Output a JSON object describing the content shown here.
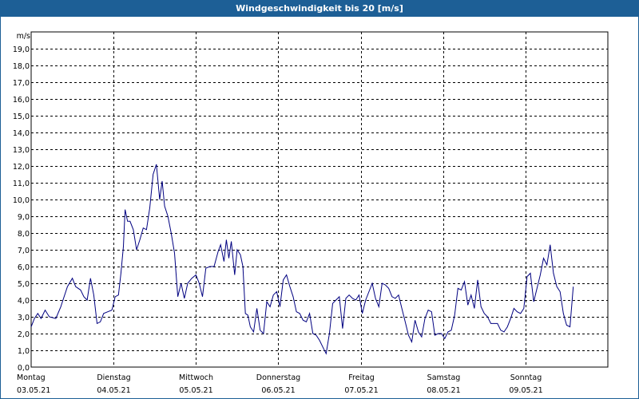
{
  "window": {
    "title": "Windgeschwindigkeit bis 20 [m/s]"
  },
  "colors": {
    "titlebar": "#1d5f96",
    "series": "#000080",
    "grid": "#000000"
  },
  "chart_data": {
    "type": "line",
    "title": "Windgeschwindigkeit bis 20 [m/s]",
    "ylabel": "m/s",
    "ylim": [
      0,
      20
    ],
    "yticks": [
      "0,0",
      "1,0",
      "2,0",
      "3,0",
      "4,0",
      "5,0",
      "6,0",
      "7,0",
      "8,0",
      "9,0",
      "10,0",
      "11,0",
      "12,0",
      "13,0",
      "14,0",
      "15,0",
      "16,0",
      "17,0",
      "18,0",
      "19,0"
    ],
    "xlim": [
      0,
      7
    ],
    "grid": true,
    "x_categories": [
      {
        "day": "Montag",
        "date": "03.05.21"
      },
      {
        "day": "Dienstag",
        "date": "04.05.21"
      },
      {
        "day": "Mittwoch",
        "date": "05.05.21"
      },
      {
        "day": "Donnerstag",
        "date": "06.05.21"
      },
      {
        "day": "Freitag",
        "date": "07.05.21"
      },
      {
        "day": "Samstag",
        "date": "08.05.21"
      },
      {
        "day": "Sonntag",
        "date": "09.05.21"
      }
    ],
    "series": [
      {
        "points": [
          [
            0.0,
            2.4
          ],
          [
            0.04,
            2.9
          ],
          [
            0.08,
            3.2
          ],
          [
            0.12,
            2.9
          ],
          [
            0.17,
            3.4
          ],
          [
            0.22,
            3.0
          ],
          [
            0.3,
            2.9
          ],
          [
            0.36,
            3.6
          ],
          [
            0.44,
            4.8
          ],
          [
            0.5,
            5.3
          ],
          [
            0.54,
            4.8
          ],
          [
            0.6,
            4.6
          ],
          [
            0.64,
            4.2
          ],
          [
            0.68,
            4.0
          ],
          [
            0.72,
            5.3
          ],
          [
            0.76,
            4.3
          ],
          [
            0.8,
            2.6
          ],
          [
            0.84,
            2.7
          ],
          [
            0.88,
            3.2
          ],
          [
            0.93,
            3.3
          ],
          [
            0.98,
            3.4
          ],
          [
            1.02,
            4.2
          ],
          [
            1.06,
            4.3
          ],
          [
            1.09,
            5.6
          ],
          [
            1.12,
            7.2
          ],
          [
            1.14,
            9.4
          ],
          [
            1.17,
            8.7
          ],
          [
            1.2,
            8.7
          ],
          [
            1.24,
            8.2
          ],
          [
            1.28,
            7.0
          ],
          [
            1.32,
            7.6
          ],
          [
            1.36,
            8.3
          ],
          [
            1.4,
            8.2
          ],
          [
            1.44,
            9.5
          ],
          [
            1.48,
            11.5
          ],
          [
            1.52,
            12.1
          ],
          [
            1.56,
            10.0
          ],
          [
            1.59,
            11.1
          ],
          [
            1.62,
            9.6
          ],
          [
            1.66,
            9.0
          ],
          [
            1.7,
            8.0
          ],
          [
            1.74,
            6.8
          ],
          [
            1.78,
            4.2
          ],
          [
            1.82,
            5.0
          ],
          [
            1.86,
            4.1
          ],
          [
            1.9,
            5.0
          ],
          [
            1.95,
            5.3
          ],
          [
            2.0,
            5.5
          ],
          [
            2.04,
            5.0
          ],
          [
            2.08,
            4.2
          ],
          [
            2.12,
            5.9
          ],
          [
            2.17,
            6.0
          ],
          [
            2.22,
            6.0
          ],
          [
            2.27,
            6.9
          ],
          [
            2.3,
            7.3
          ],
          [
            2.34,
            6.3
          ],
          [
            2.37,
            7.6
          ],
          [
            2.4,
            6.5
          ],
          [
            2.43,
            7.5
          ],
          [
            2.47,
            5.5
          ],
          [
            2.5,
            7.0
          ],
          [
            2.54,
            6.7
          ],
          [
            2.57,
            6.0
          ],
          [
            2.6,
            3.2
          ],
          [
            2.63,
            3.1
          ],
          [
            2.66,
            2.4
          ],
          [
            2.7,
            2.1
          ],
          [
            2.74,
            3.5
          ],
          [
            2.78,
            2.2
          ],
          [
            2.82,
            2.0
          ],
          [
            2.86,
            3.9
          ],
          [
            2.9,
            3.6
          ],
          [
            2.94,
            4.3
          ],
          [
            2.98,
            4.5
          ],
          [
            3.02,
            3.6
          ],
          [
            3.06,
            5.2
          ],
          [
            3.1,
            5.5
          ],
          [
            3.14,
            4.8
          ],
          [
            3.18,
            4.2
          ],
          [
            3.22,
            3.3
          ],
          [
            3.26,
            3.2
          ],
          [
            3.3,
            2.8
          ],
          [
            3.34,
            2.7
          ],
          [
            3.38,
            3.2
          ],
          [
            3.42,
            2.0
          ],
          [
            3.46,
            1.9
          ],
          [
            3.5,
            1.6
          ],
          [
            3.54,
            1.2
          ],
          [
            3.58,
            0.8
          ],
          [
            3.62,
            2.0
          ],
          [
            3.66,
            3.8
          ],
          [
            3.7,
            4.0
          ],
          [
            3.74,
            4.2
          ],
          [
            3.78,
            2.3
          ],
          [
            3.82,
            4.1
          ],
          [
            3.86,
            4.3
          ],
          [
            3.9,
            4.1
          ],
          [
            3.94,
            4.0
          ],
          [
            3.98,
            4.3
          ],
          [
            4.02,
            3.2
          ],
          [
            4.06,
            4.0
          ],
          [
            4.1,
            4.5
          ],
          [
            4.14,
            5.0
          ],
          [
            4.18,
            4.1
          ],
          [
            4.22,
            3.6
          ],
          [
            4.26,
            5.0
          ],
          [
            4.3,
            4.9
          ],
          [
            4.34,
            4.7
          ],
          [
            4.38,
            4.2
          ],
          [
            4.42,
            4.1
          ],
          [
            4.46,
            4.3
          ],
          [
            4.5,
            3.5
          ],
          [
            4.54,
            2.7
          ],
          [
            4.58,
            1.9
          ],
          [
            4.62,
            1.5
          ],
          [
            4.66,
            2.8
          ],
          [
            4.7,
            2.1
          ],
          [
            4.74,
            1.8
          ],
          [
            4.78,
            2.9
          ],
          [
            4.82,
            3.4
          ],
          [
            4.86,
            3.3
          ],
          [
            4.9,
            1.9
          ],
          [
            4.94,
            2.0
          ],
          [
            4.98,
            2.0
          ],
          [
            5.02,
            1.7
          ],
          [
            5.06,
            2.1
          ],
          [
            5.1,
            2.2
          ],
          [
            5.14,
            3.1
          ],
          [
            5.18,
            4.7
          ],
          [
            5.22,
            4.6
          ],
          [
            5.26,
            5.1
          ],
          [
            5.3,
            3.7
          ],
          [
            5.34,
            4.3
          ],
          [
            5.38,
            3.5
          ],
          [
            5.42,
            5.2
          ],
          [
            5.46,
            3.6
          ],
          [
            5.5,
            3.2
          ],
          [
            5.54,
            3.0
          ],
          [
            5.58,
            2.6
          ],
          [
            5.62,
            2.6
          ],
          [
            5.66,
            2.6
          ],
          [
            5.7,
            2.2
          ],
          [
            5.74,
            2.1
          ],
          [
            5.78,
            2.4
          ],
          [
            5.82,
            2.9
          ],
          [
            5.86,
            3.5
          ],
          [
            5.9,
            3.3
          ],
          [
            5.94,
            3.2
          ],
          [
            5.98,
            3.5
          ],
          [
            6.02,
            5.4
          ],
          [
            6.06,
            5.6
          ],
          [
            6.1,
            3.9
          ],
          [
            6.14,
            4.7
          ],
          [
            6.18,
            5.5
          ],
          [
            6.22,
            6.5
          ],
          [
            6.26,
            6.1
          ],
          [
            6.3,
            7.3
          ],
          [
            6.34,
            5.6
          ],
          [
            6.38,
            4.8
          ],
          [
            6.42,
            4.5
          ],
          [
            6.46,
            3.2
          ],
          [
            6.5,
            2.5
          ],
          [
            6.54,
            2.4
          ],
          [
            6.58,
            4.8
          ]
        ]
      }
    ]
  }
}
